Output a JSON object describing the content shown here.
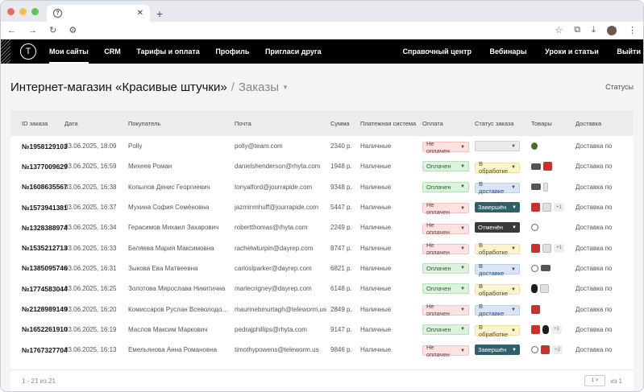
{
  "browser": {
    "tab_icon_label": "?",
    "new_tab": "+"
  },
  "nav": {
    "left": [
      "Мои сайты",
      "CRM",
      "Тарифы и оплата",
      "Профиль",
      "Пригласи друга"
    ],
    "right": [
      "Справочный центр",
      "Вебинары",
      "Уроки и статьи",
      "Выйти"
    ],
    "logo": "Т"
  },
  "page": {
    "title": "Интернет-магазин «Красивые штучки»",
    "separator": "/",
    "subtitle": "Заказы",
    "statuses_link": "Статусы"
  },
  "table": {
    "columns": [
      "ID заказа",
      "Дата",
      "Покупатель",
      "Почта",
      "Сумма",
      "Платежная система",
      "Оплата",
      "Статус заказа",
      "Товары",
      "Доставка"
    ],
    "rows": [
      {
        "id": "№1958129103",
        "date": "03.06.2025, 18:09",
        "buyer": "Polly",
        "email": "polly@team.com",
        "sum": "2340 р.",
        "system": "Наличные",
        "pay": "Не оплачен",
        "pay_color": "red",
        "status": "",
        "status_color": "empty",
        "goods": [
          "plant"
        ],
        "more": "",
        "delivery": "Доставка по"
      },
      {
        "id": "№1377009629",
        "date": "03.06.2025, 16:59",
        "buyer": "Михеев Роман",
        "email": "danielshenderson@rhyta.com",
        "sum": "1948 р.",
        "system": "Наличные",
        "pay": "Оплачен",
        "pay_color": "green",
        "status": "В обработке",
        "status_color": "yellow",
        "goods": [
          "cam",
          "red"
        ],
        "more": "",
        "delivery": "Доставка по"
      },
      {
        "id": "№1608635567",
        "date": "03.06.2025, 16:38",
        "buyer": "Копылов Денис Георгиевич",
        "email": "tonyalford@jourrapide.com",
        "sum": "9348 р.",
        "system": "Наличные",
        "pay": "Оплачен",
        "pay_color": "green",
        "status": "В доставке",
        "status_color": "blue",
        "goods": [
          "cam",
          "bottle"
        ],
        "more": "",
        "delivery": "Доставка по"
      },
      {
        "id": "№1573941381",
        "date": "03.06.2025, 16:37",
        "buyer": "Мухина София Семёновна",
        "email": "jazminmhuff@jourrapide.com",
        "sum": "5447 р.",
        "system": "Наличные",
        "pay": "Не оплачен",
        "pay_color": "red",
        "status": "Завершён",
        "status_color": "teal",
        "goods": [
          "red",
          "bag"
        ],
        "more": "+1",
        "delivery": "Доставка по"
      },
      {
        "id": "№1328388974",
        "date": "03.06.2025, 16:34",
        "buyer": "Герасимов Михаил Захарович",
        "email": "robertthomas@rhyta.com",
        "sum": "2249 р.",
        "system": "Наличные",
        "pay": "Не оплачен",
        "pay_color": "red",
        "status": "Отменён",
        "status_color": "dark",
        "goods": [
          "clock"
        ],
        "more": "",
        "delivery": "Доставка по"
      },
      {
        "id": "№1535212713",
        "date": "03.06.2025, 16:33",
        "buyer": "Беляева Мария Максимовна",
        "email": "rachelwturpin@dayrep.com",
        "sum": "8747 р.",
        "system": "Наличные",
        "pay": "Не оплачен",
        "pay_color": "red",
        "status": "В обработке",
        "status_color": "yellow",
        "goods": [
          "red",
          "bag"
        ],
        "more": "+1",
        "delivery": "Доставка по"
      },
      {
        "id": "№1385095746",
        "date": "03.06.2025, 16:31",
        "buyer": "Зыкова Ева Матвеевна",
        "email": "carloslparker@dayrep.com",
        "sum": "6821 р.",
        "system": "Наличные",
        "pay": "Оплачен",
        "pay_color": "green",
        "status": "В доставке",
        "status_color": "blue",
        "goods": [
          "clock",
          "cam"
        ],
        "more": "",
        "delivery": "Доставка по"
      },
      {
        "id": "№1774583044",
        "date": "03.06.2025, 16:25",
        "buyer": "Золотова Мирослава Никитична",
        "email": "mariecrigney@dayrep.com",
        "sum": "6148 р.",
        "system": "Наличные",
        "pay": "Оплачен",
        "pay_color": "green",
        "status": "В обработке",
        "status_color": "yellow",
        "goods": [
          "black",
          "bag"
        ],
        "more": "",
        "delivery": "Доставка по"
      },
      {
        "id": "№2128989149",
        "date": "03.06.2025, 16:20",
        "buyer": "Комиссаров Руслан Всеволодов…",
        "email": "maurinebmurtagh@teleworm.us",
        "sum": "2849 р.",
        "system": "Наличные",
        "pay": "Не оплачен",
        "pay_color": "red",
        "status": "В доставке",
        "status_color": "blue",
        "goods": [
          "red"
        ],
        "more": "",
        "delivery": "Доставка по"
      },
      {
        "id": "№1652261910",
        "date": "03.06.2025, 16:19",
        "buyer": "Маслов Максим Маркович",
        "email": "pedrajphillips@rhyta.com",
        "sum": "9147 р.",
        "system": "Наличные",
        "pay": "Оплачен",
        "pay_color": "green",
        "status": "В обработке",
        "status_color": "yellow",
        "goods": [
          "red",
          "black"
        ],
        "more": "+1",
        "delivery": "Доставка по"
      },
      {
        "id": "№1767327704",
        "date": "03.06.2025, 16:13",
        "buyer": "Емельянова Анна Романовна",
        "email": "timothypowens@teleworm.us",
        "sum": "9846 р.",
        "system": "Наличные",
        "pay": "Не оплачен",
        "pay_color": "red",
        "status": "Завершён",
        "status_color": "teal",
        "goods": [
          "clock",
          "red"
        ],
        "more": "+2",
        "delivery": "Доставка по"
      }
    ]
  },
  "footer": {
    "range": "1 - 21 из 21",
    "page_select": "1",
    "of_pages": "из 1"
  }
}
